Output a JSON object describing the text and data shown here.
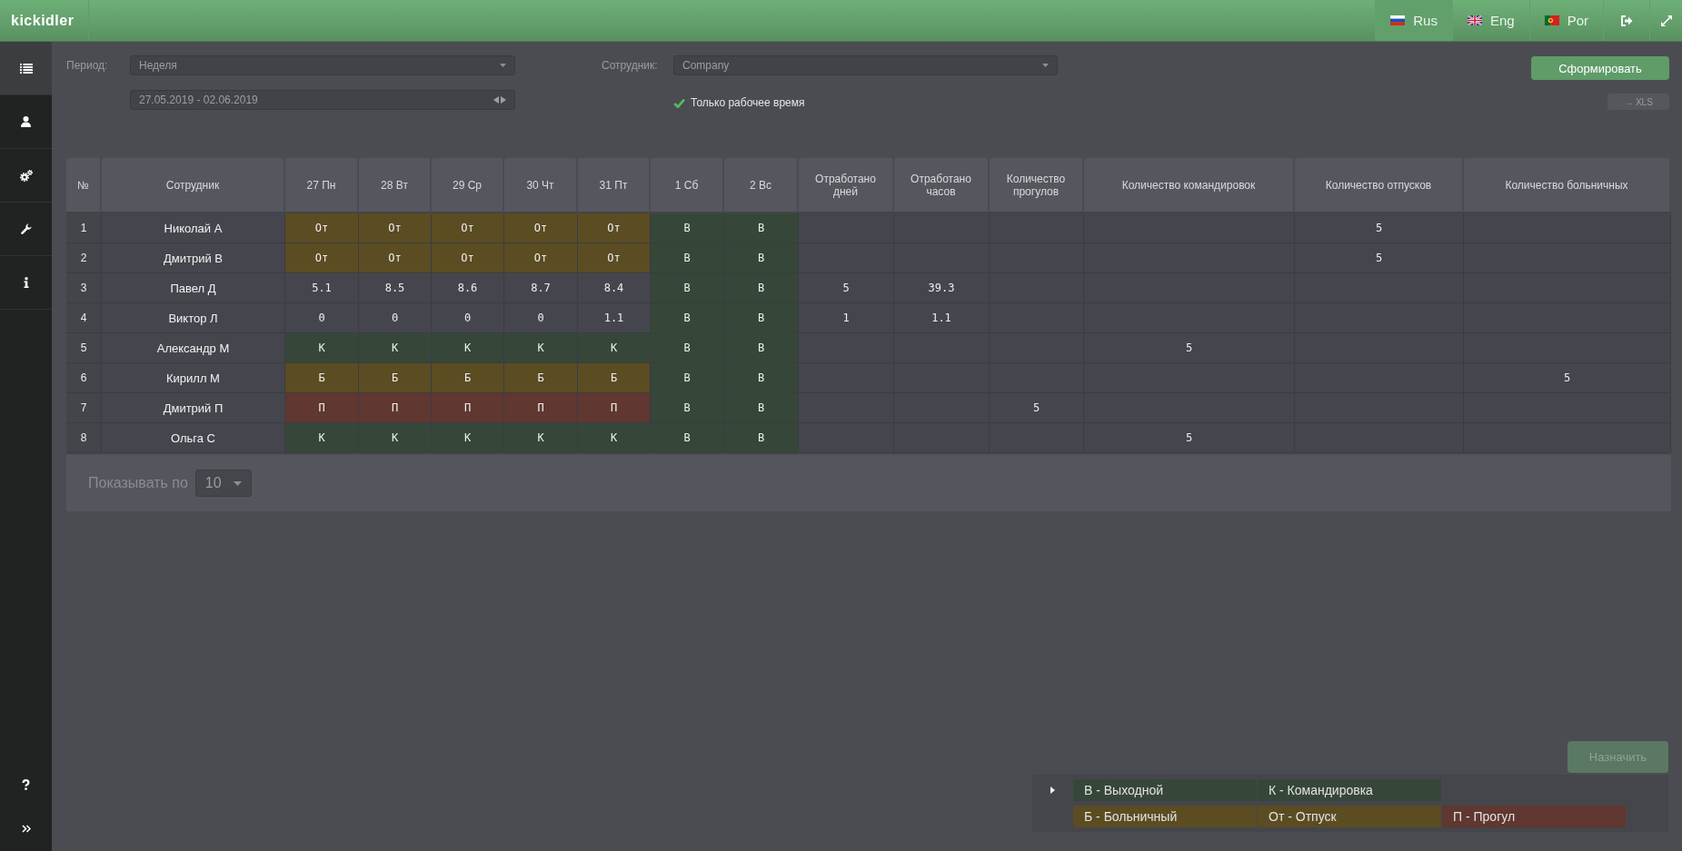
{
  "top_bar": {
    "logo": "kickidler",
    "languages": [
      {
        "label": "Rus",
        "selected": true
      },
      {
        "label": "Eng",
        "selected": false
      },
      {
        "label": "Por",
        "selected": false
      }
    ]
  },
  "sidebar": {
    "items": [
      {
        "selected": true
      },
      {
        "selected": false
      },
      {
        "selected": false
      },
      {
        "selected": false
      },
      {
        "selected": false
      }
    ]
  },
  "filters": {
    "period": {
      "label": "Период:",
      "value": "Неделя"
    },
    "date_range": {
      "value": "27.05.2019 - 02.06.2019"
    },
    "employee": {
      "label": "Сотрудник:",
      "value": "Company"
    },
    "working_time_only": {
      "label": "Только рабочее время",
      "checked": true
    },
    "generate_button": "Сформировать",
    "export_button": "→ XLS"
  },
  "table": {
    "columns": [
      "№",
      "Сотрудник",
      "27 Пн",
      "28 Вт",
      "29 Ср",
      "30 Чт",
      "31 Пт",
      "1 Сб",
      "2 Вс",
      "Отработано дней",
      "Отработано часов",
      "Количество прогулов",
      "Количество командировок",
      "Количество отпусков",
      "Количество больничных"
    ],
    "rows": [
      {
        "number": "1",
        "employee": "Николай А",
        "days": [
          {
            "text": "От",
            "color": "#5b4c22"
          },
          {
            "text": "От",
            "color": "#5b4c22"
          },
          {
            "text": "От",
            "color": "#5b4c22"
          },
          {
            "text": "От",
            "color": "#5b4c22"
          },
          {
            "text": "От",
            "color": "#5b4c22"
          },
          {
            "text": "В",
            "color": "#364739"
          },
          {
            "text": "В",
            "color": "#364739"
          }
        ],
        "vacations": "5"
      },
      {
        "number": "2",
        "employee": "Дмитрий В",
        "days": [
          {
            "text": "От",
            "color": "#5b4c22"
          },
          {
            "text": "От",
            "color": "#5b4c22"
          },
          {
            "text": "От",
            "color": "#5b4c22"
          },
          {
            "text": "От",
            "color": "#5b4c22"
          },
          {
            "text": "От",
            "color": "#5b4c22"
          },
          {
            "text": "В",
            "color": "#364739"
          },
          {
            "text": "В",
            "color": "#364739"
          }
        ],
        "vacations": "5"
      },
      {
        "number": "3",
        "employee": "Павел Д",
        "days": [
          {
            "text": "5.1"
          },
          {
            "text": "8.5"
          },
          {
            "text": "8.6"
          },
          {
            "text": "8.7"
          },
          {
            "text": "8.4"
          },
          {
            "text": "В",
            "color": "#364739"
          },
          {
            "text": "В",
            "color": "#364739"
          }
        ],
        "worked_days": "5",
        "worked_hours": "39.3"
      },
      {
        "number": "4",
        "employee": "Виктор Л",
        "days": [
          {
            "text": "0"
          },
          {
            "text": "0"
          },
          {
            "text": "0"
          },
          {
            "text": "0"
          },
          {
            "text": "1.1"
          },
          {
            "text": "В",
            "color": "#364739"
          },
          {
            "text": "В",
            "color": "#364739"
          }
        ],
        "worked_days": "1",
        "worked_hours": "1.1"
      },
      {
        "number": "5",
        "employee": "Александр М",
        "days": [
          {
            "text": "К",
            "color": "#364739"
          },
          {
            "text": "К",
            "color": "#364739"
          },
          {
            "text": "К",
            "color": "#364739"
          },
          {
            "text": "К",
            "color": "#364739"
          },
          {
            "text": "К",
            "color": "#364739"
          },
          {
            "text": "В",
            "color": "#364739"
          },
          {
            "text": "В",
            "color": "#364739"
          }
        ],
        "business_trips": "5"
      },
      {
        "number": "6",
        "employee": "Кирилл М",
        "days": [
          {
            "text": "Б",
            "color": "#5b4c22"
          },
          {
            "text": "Б",
            "color": "#5b4c22"
          },
          {
            "text": "Б",
            "color": "#5b4c22"
          },
          {
            "text": "Б",
            "color": "#5b4c22"
          },
          {
            "text": "Б",
            "color": "#5b4c22"
          },
          {
            "text": "В",
            "color": "#364739"
          },
          {
            "text": "В",
            "color": "#364739"
          }
        ],
        "sick_leaves": "5"
      },
      {
        "number": "7",
        "employee": "Дмитрий П",
        "days": [
          {
            "text": "П",
            "color": "#603731"
          },
          {
            "text": "П",
            "color": "#603731"
          },
          {
            "text": "П",
            "color": "#603731"
          },
          {
            "text": "П",
            "color": "#603731"
          },
          {
            "text": "П",
            "color": "#603731"
          },
          {
            "text": "В",
            "color": "#364739"
          },
          {
            "text": "В",
            "color": "#364739"
          }
        ],
        "absences": "5"
      },
      {
        "number": "8",
        "employee": "Ольга С",
        "days": [
          {
            "text": "К",
            "color": "#364739"
          },
          {
            "text": "К",
            "color": "#364739"
          },
          {
            "text": "К",
            "color": "#364739"
          },
          {
            "text": "К",
            "color": "#364739"
          },
          {
            "text": "К",
            "color": "#364739"
          },
          {
            "text": "В",
            "color": "#364739"
          },
          {
            "text": "В",
            "color": "#364739"
          }
        ],
        "business_trips": "5"
      }
    ]
  },
  "pagination": {
    "label": "Показывать по",
    "page_size": "10"
  },
  "assign_button": {
    "label": "Назначить",
    "disabled": true
  },
  "legend": {
    "rows": [
      [
        {
          "label": "В - Выходной",
          "color": "#364739"
        },
        {
          "label": "К - Командировка",
          "color": "#364739"
        }
      ],
      [
        {
          "label": "Б - Больничный",
          "color": "#5b4c22"
        },
        {
          "label": "От - Отпуск",
          "color": "#5b4c22"
        },
        {
          "label": "П - Прогул",
          "color": "#603731"
        }
      ]
    ]
  }
}
